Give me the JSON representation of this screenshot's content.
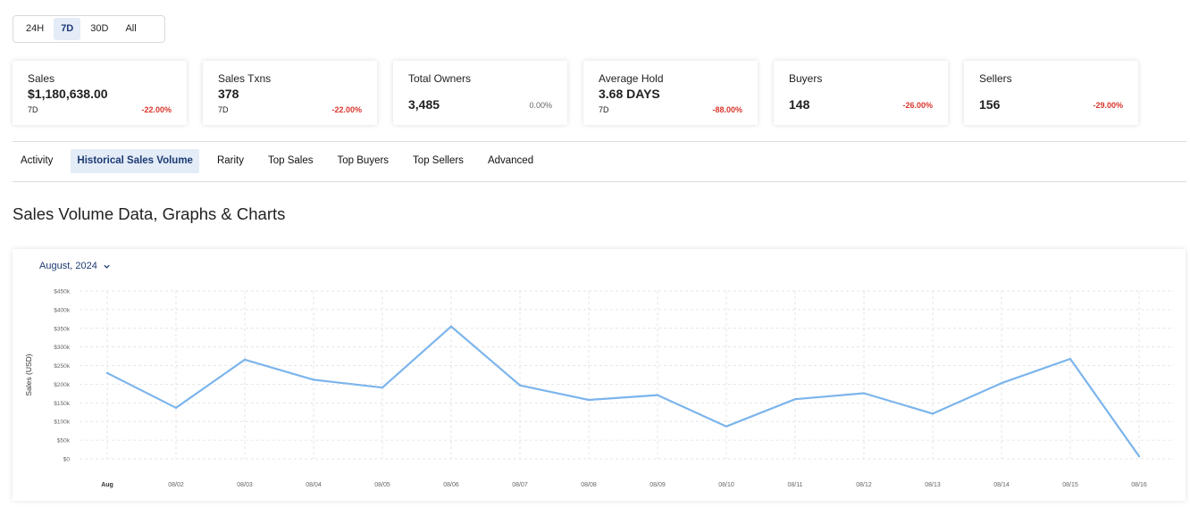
{
  "range": {
    "options": [
      "24H",
      "7D",
      "30D",
      "All"
    ],
    "selected": "7D"
  },
  "stats": [
    {
      "label": "Sales",
      "value": "$1,180,638.00",
      "period": "7D",
      "change": "-22.00%"
    },
    {
      "label": "Sales Txns",
      "value": "378",
      "period": "7D",
      "change": "-22.00%"
    },
    {
      "label": "Total Owners",
      "value": "3,485",
      "period": "",
      "change": "0.00%"
    },
    {
      "label": "Average Hold",
      "value": "3.68 DAYS",
      "period": "7D",
      "change": "-88.00%"
    },
    {
      "label": "Buyers",
      "value": "148",
      "period": "",
      "change": "-26.00%"
    },
    {
      "label": "Sellers",
      "value": "156",
      "period": "",
      "change": "-29.00%"
    }
  ],
  "tabs": [
    {
      "label": "Activity"
    },
    {
      "label": "Historical Sales Volume",
      "active": true
    },
    {
      "label": "Rarity"
    },
    {
      "label": "Top Sales"
    },
    {
      "label": "Top Buyers"
    },
    {
      "label": "Top Sellers"
    },
    {
      "label": "Advanced"
    }
  ],
  "section_title": "Sales Volume Data, Graphs & Charts",
  "month_selector": {
    "label": "August, 2024",
    "icon": "chevron-down-icon"
  },
  "colors": {
    "accent": "#1e3a73",
    "negative": "#d9362c",
    "line": "#7cb5ec",
    "tab_active_bg": "#e3ecf7"
  },
  "chart_data": {
    "type": "line",
    "x": [
      "Aug",
      "08/02",
      "08/03",
      "08/04",
      "08/05",
      "08/06",
      "08/07",
      "08/08",
      "08/09",
      "08/10",
      "08/11",
      "08/12",
      "08/13",
      "08/14",
      "08/15",
      "08/16"
    ],
    "series": [
      {
        "values": [
          230000,
          137000,
          266000,
          212000,
          191000,
          355000,
          197000,
          158000,
          171000,
          87000,
          160000,
          176000,
          121000,
          203000,
          268000,
          7000
        ]
      }
    ],
    "ylabel": "Sales (USD)",
    "ylim": [
      0,
      450000
    ],
    "y_ticks": [
      0,
      50000,
      100000,
      150000,
      200000,
      250000,
      300000,
      350000,
      400000,
      450000
    ],
    "y_tick_labels": [
      "$0",
      "$50k",
      "$100k",
      "$150k",
      "$200k",
      "$250k",
      "$300k",
      "$350k",
      "$400k",
      "$450k"
    ],
    "grid": true
  }
}
